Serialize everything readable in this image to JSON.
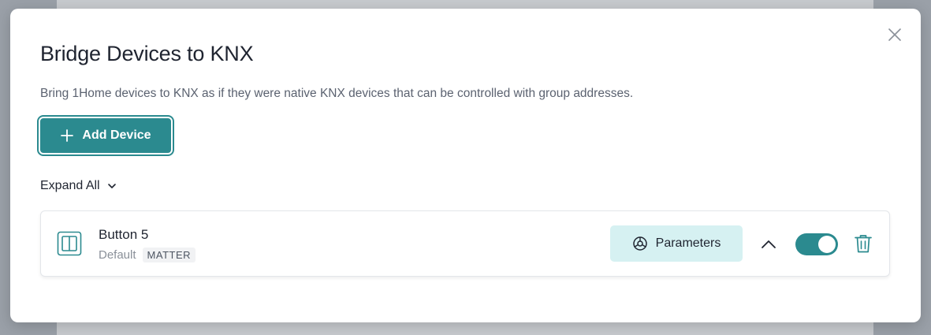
{
  "modal": {
    "title": "Bridge Devices to KNX",
    "description": "Bring 1Home devices to KNX as if they were native KNX devices that can be controlled with group addresses.",
    "close_icon": "close-icon"
  },
  "toolbar": {
    "add_device_label": "Add Device",
    "add_icon": "plus-icon"
  },
  "expand": {
    "label": "Expand All",
    "icon": "chevron-down-icon"
  },
  "devices": [
    {
      "name": "Button 5",
      "profile": "Default",
      "badge": "MATTER",
      "icon": "device-panel-icon",
      "parameters_label": "Parameters",
      "parameters_icon": "gear-icon",
      "expanded": true,
      "enabled": true
    }
  ],
  "colors": {
    "accent": "#2b8a8f",
    "accent_light": "#d6f1f2",
    "text_primary": "#1f2430",
    "text_secondary": "#5b6270"
  }
}
